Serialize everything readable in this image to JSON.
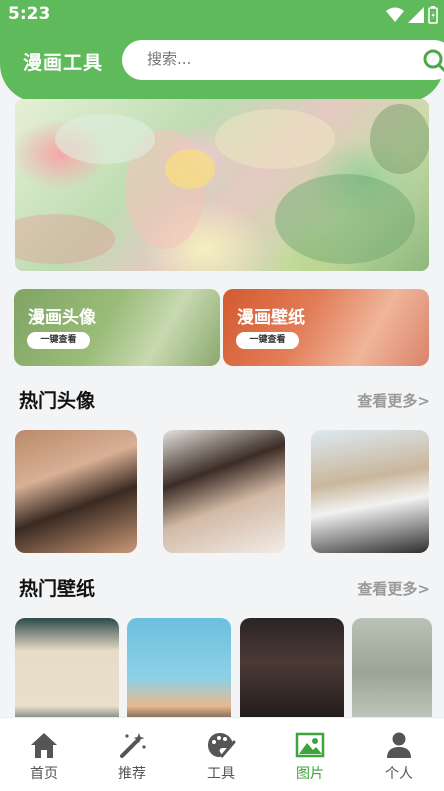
{
  "status_bar": {
    "time": "5:23"
  },
  "header": {
    "app_title": "漫画工具",
    "search_placeholder": "搜索..."
  },
  "categories": [
    {
      "title": "漫画头像",
      "button": "一键查看"
    },
    {
      "title": "漫画壁纸",
      "button": "一键查看"
    }
  ],
  "sections": {
    "hot_avatars": {
      "title": "热门头像",
      "more": "查看更多>"
    },
    "hot_wallpapers": {
      "title": "热门壁纸",
      "more": "查看更多>"
    }
  },
  "nav": {
    "items": [
      {
        "label": "首页",
        "icon": "home-icon"
      },
      {
        "label": "推荐",
        "icon": "magic-wand-icon"
      },
      {
        "label": "工具",
        "icon": "palette-icon"
      },
      {
        "label": "图片",
        "icon": "image-icon"
      },
      {
        "label": "个人",
        "icon": "person-icon"
      }
    ],
    "active_label": "图片"
  },
  "colors": {
    "brand_green": "#5fba5c",
    "active_green": "#3fa33c",
    "muted": "#9a9a9a"
  }
}
